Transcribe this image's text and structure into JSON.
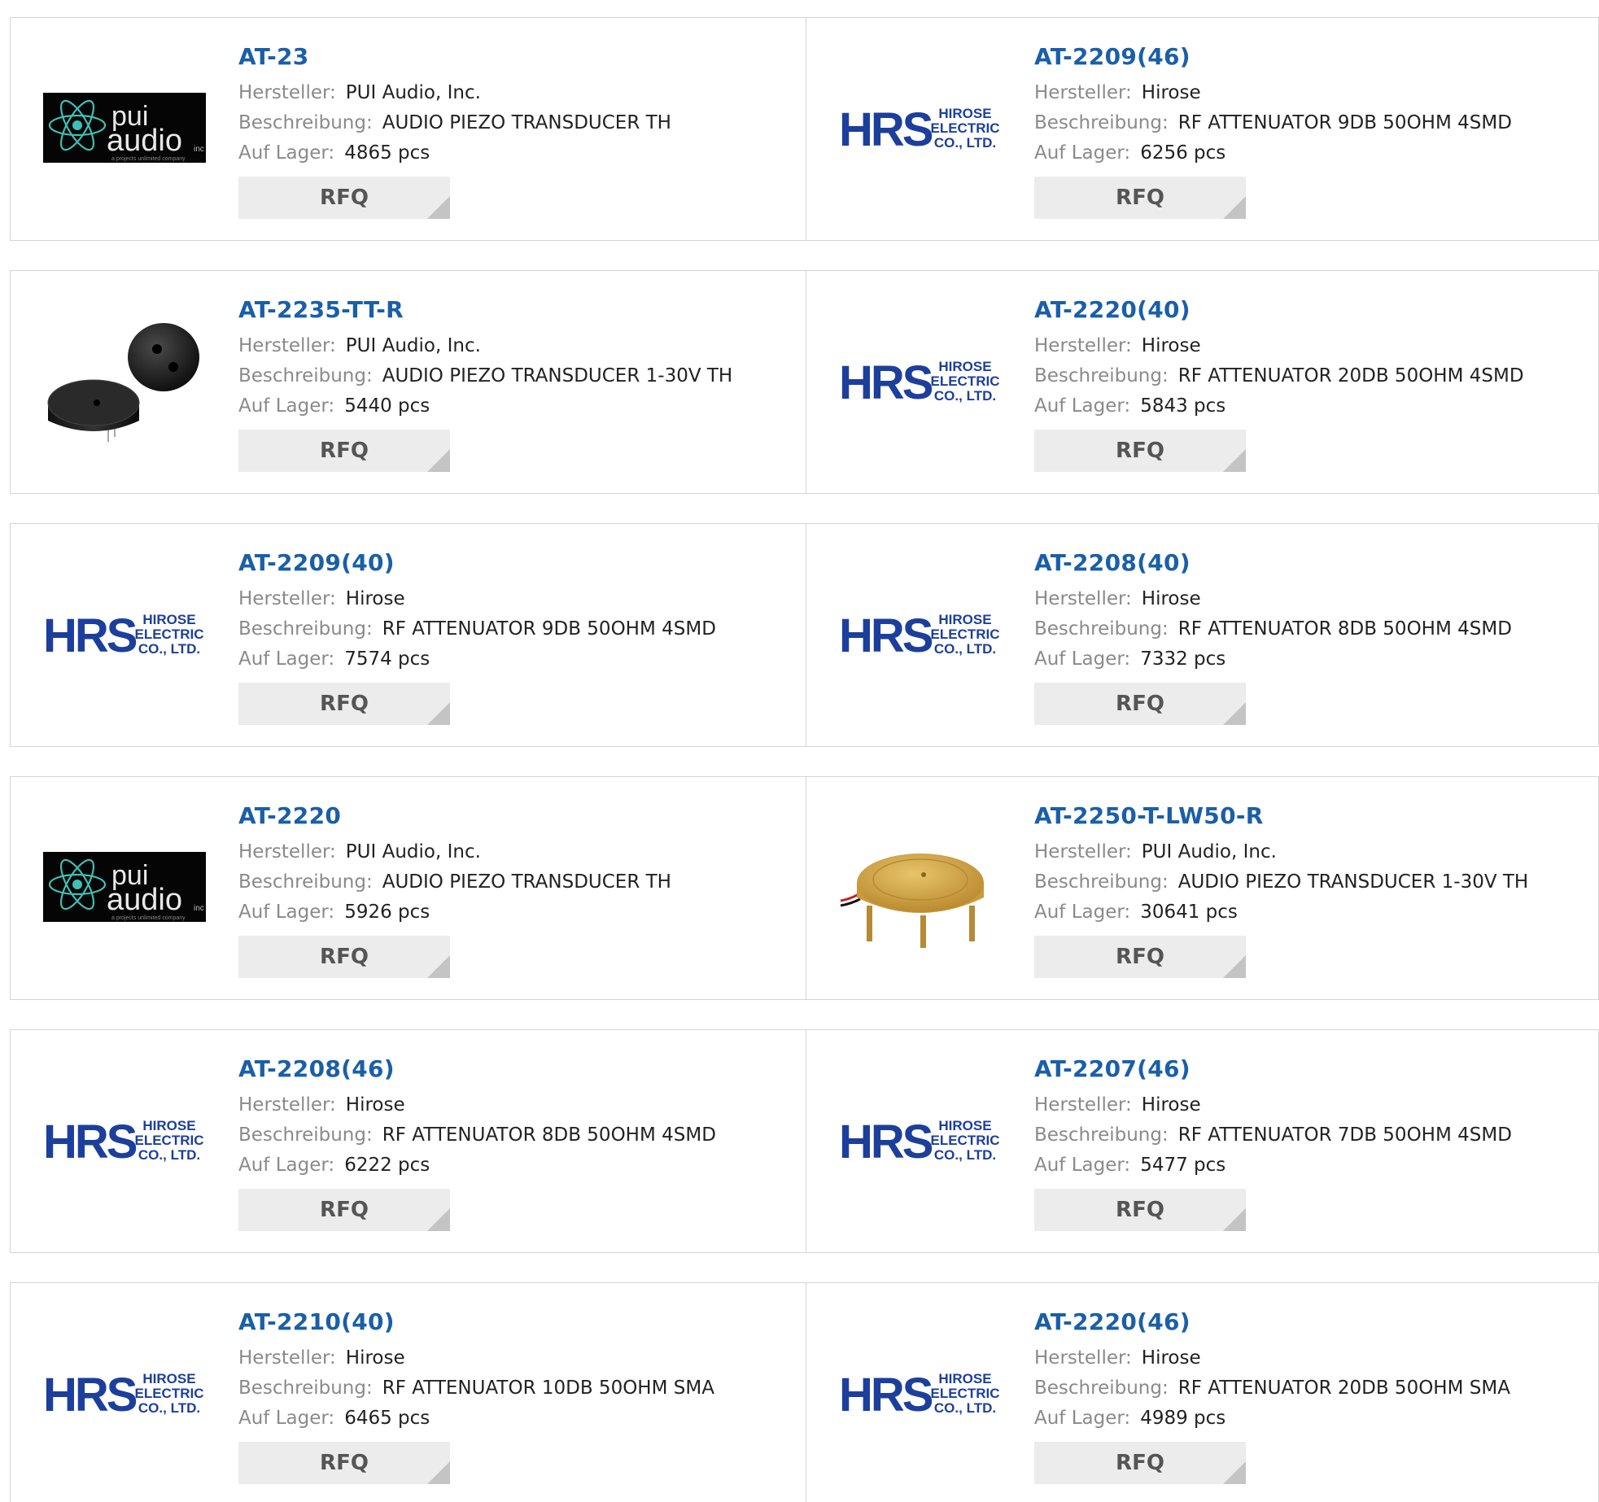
{
  "labels": {
    "manufacturer": "Hersteller:",
    "description": "Beschreibung:",
    "stock": "Auf Lager:",
    "rfq": "RFQ"
  },
  "logo_text": {
    "pui_line1": "pui",
    "pui_line2": "audio",
    "pui_inc": "inc",
    "pui_tagline": "a projects unlimited company",
    "hrs_mark": "HRS",
    "hrs_line1": "HIROSE",
    "hrs_line2": "ELECTRIC",
    "hrs_line3": "CO., LTD."
  },
  "products": [
    {
      "part": "AT-23",
      "manufacturer": "PUI Audio, Inc.",
      "description": "AUDIO PIEZO TRANSDUCER TH",
      "stock": "4865 pcs",
      "image": "pui-audio-logo"
    },
    {
      "part": "AT-2209(46)",
      "manufacturer": "Hirose",
      "description": "RF ATTENUATOR 9DB 50OHM 4SMD",
      "stock": "6256 pcs",
      "image": "hirose-logo"
    },
    {
      "part": "AT-2235-TT-R",
      "manufacturer": "PUI Audio, Inc.",
      "description": "AUDIO PIEZO TRANSDUCER 1-30V TH",
      "stock": "5440 pcs",
      "image": "black-buzzer-photo"
    },
    {
      "part": "AT-2220(40)",
      "manufacturer": "Hirose",
      "description": "RF ATTENUATOR 20DB 50OHM 4SMD",
      "stock": "5843 pcs",
      "image": "hirose-logo"
    },
    {
      "part": "AT-2209(40)",
      "manufacturer": "Hirose",
      "description": "RF ATTENUATOR 9DB 50OHM 4SMD",
      "stock": "7574 pcs",
      "image": "hirose-logo"
    },
    {
      "part": "AT-2208(40)",
      "manufacturer": "Hirose",
      "description": "RF ATTENUATOR 8DB 50OHM 4SMD",
      "stock": "7332 pcs",
      "image": "hirose-logo"
    },
    {
      "part": "AT-2220",
      "manufacturer": "PUI Audio, Inc.",
      "description": "AUDIO PIEZO TRANSDUCER TH",
      "stock": "5926 pcs",
      "image": "pui-audio-logo"
    },
    {
      "part": "AT-2250-T-LW50-R",
      "manufacturer": "PUI Audio, Inc.",
      "description": "AUDIO PIEZO TRANSDUCER 1-30V TH",
      "stock": "30641 pcs",
      "image": "gold-transducer-photo"
    },
    {
      "part": "AT-2208(46)",
      "manufacturer": "Hirose",
      "description": "RF ATTENUATOR 8DB 50OHM 4SMD",
      "stock": "6222 pcs",
      "image": "hirose-logo"
    },
    {
      "part": "AT-2207(46)",
      "manufacturer": "Hirose",
      "description": "RF ATTENUATOR 7DB 50OHM 4SMD",
      "stock": "5477 pcs",
      "image": "hirose-logo"
    },
    {
      "part": "AT-2210(40)",
      "manufacturer": "Hirose",
      "description": "RF ATTENUATOR 10DB 50OHM SMA",
      "stock": "6465 pcs",
      "image": "hirose-logo"
    },
    {
      "part": "AT-2220(46)",
      "manufacturer": "Hirose",
      "description": "RF ATTENUATOR 20DB 50OHM SMA",
      "stock": "4989 pcs",
      "image": "hirose-logo"
    }
  ],
  "colors": {
    "part_link": "#1a5fa8",
    "label_gray": "#8a8a8a",
    "border": "#d5d5d5",
    "rfq_bg": "#ececec",
    "hirose_blue": "#1d3f9c",
    "pui_teal": "#3fbfb5"
  }
}
